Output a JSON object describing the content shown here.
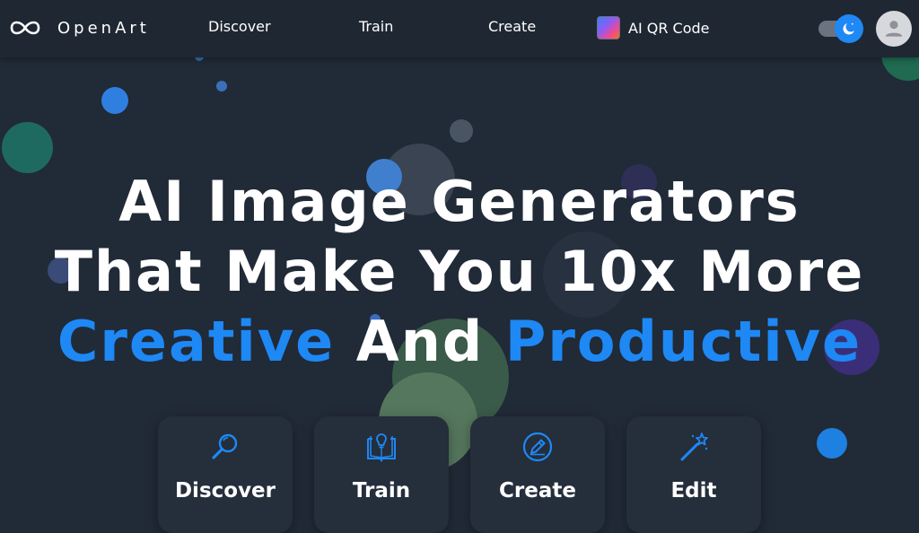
{
  "brand": {
    "name": "OpenArt"
  },
  "nav": {
    "discover": "Discover",
    "train": "Train",
    "create": "Create",
    "qr": "AI QR Code"
  },
  "theme_toggle": {
    "mode": "dark",
    "icon": "moon-icon"
  },
  "user": {
    "avatar_icon": "person-icon"
  },
  "hero": {
    "line1": "AI Image Generators",
    "line2": "That Make You 10x More",
    "line3_a": "Creative",
    "line3_b": "And",
    "line3_c": "Productive"
  },
  "cards": [
    {
      "label": "Discover",
      "icon": "search-icon"
    },
    {
      "label": "Train",
      "icon": "book-lightbulb-icon"
    },
    {
      "label": "Create",
      "icon": "pencil-icon"
    },
    {
      "label": "Edit",
      "icon": "magic-wand-icon"
    }
  ],
  "colors": {
    "background": "#212a37",
    "accent": "#1e88f5",
    "card": "#252e3b"
  }
}
